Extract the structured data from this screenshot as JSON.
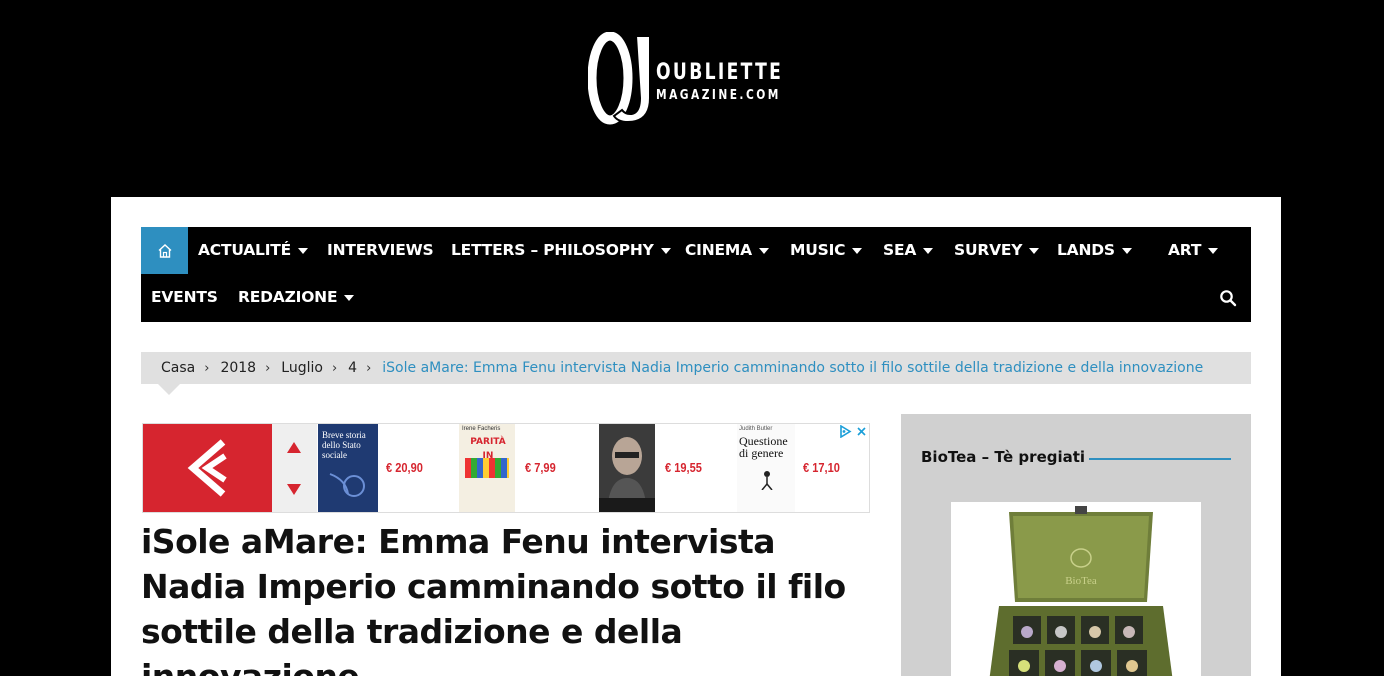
{
  "logo": {
    "line1": "OUBLIETTE",
    "line2": "MAGAZINE.COM"
  },
  "nav": {
    "home_icon": "home-icon",
    "items": [
      {
        "label": "ACTUALITÉ",
        "has_dropdown": true
      },
      {
        "label": "INTERVIEWS",
        "has_dropdown": false
      },
      {
        "label": "LETTERS – PHILOSOPHY",
        "has_dropdown": true
      },
      {
        "label": "CINEMA",
        "has_dropdown": true
      },
      {
        "label": "MUSIC",
        "has_dropdown": true
      },
      {
        "label": "SEA",
        "has_dropdown": true
      },
      {
        "label": "SURVEY",
        "has_dropdown": true
      },
      {
        "label": "LANDS",
        "has_dropdown": true
      },
      {
        "label": "ART",
        "has_dropdown": true
      },
      {
        "label": "EVENTS",
        "has_dropdown": false
      },
      {
        "label": "REDAZIONE",
        "has_dropdown": true
      }
    ],
    "search_icon": "search-icon",
    "accent_color": "#2e8fc0"
  },
  "breadcrumb": {
    "items": [
      "Casa",
      "2018",
      "Luglio",
      "4"
    ],
    "current": "iSole aMare: Emma Fenu intervista Nadia Imperio camminando sotto il filo sottile della tradizione e della innovazione"
  },
  "ad": {
    "brand_color": "#d6252f",
    "books": [
      {
        "title": "Breve storia dello Stato sociale",
        "price": "€ 20,90"
      },
      {
        "title": "PARITÀ IN PILLOLE",
        "author": "Irene Facheris",
        "price": "€ 7,99"
      },
      {
        "title": "",
        "price": "€ 19,55"
      },
      {
        "title": "Questione di genere",
        "author": "Judith Butler",
        "price": "€ 17,10"
      }
    ]
  },
  "article": {
    "title": "iSole aMare: Emma Fenu intervista Nadia Imperio camminando sotto il filo sottile della tradizione e della innovazione"
  },
  "sidebar": {
    "widget_title": "BioTea – Tè pregiati",
    "image_brand": "BioTea"
  }
}
